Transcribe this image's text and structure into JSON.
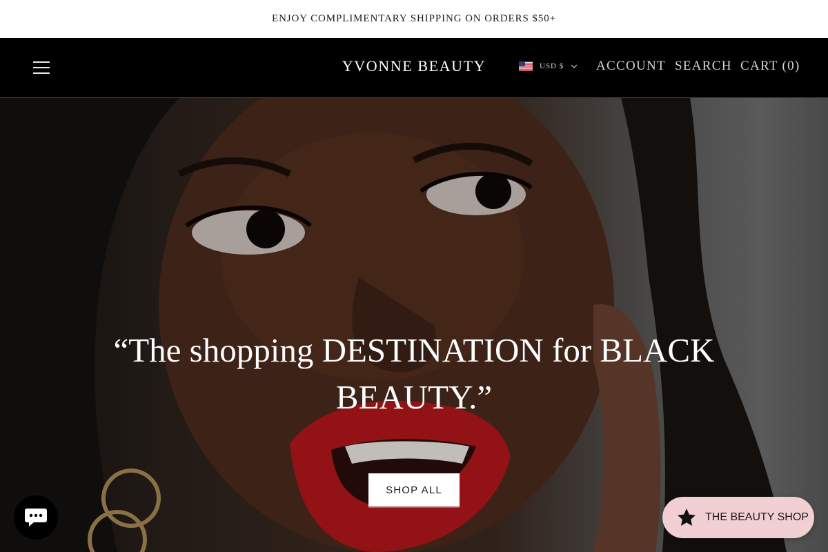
{
  "announcement": {
    "text": "ENJOY COMPLIMENTARY SHIPPING ON ORDERS $50+"
  },
  "header": {
    "logo": "YVONNE BEAUTY",
    "currency": "USD $",
    "nav": {
      "account": "ACCOUNT",
      "search": "SEARCH",
      "cart": "CART (0)"
    }
  },
  "hero": {
    "headline": "“The shopping DESTINATION for BLACK BEAUTY.”",
    "cta": "SHOP ALL"
  },
  "widgets": {
    "beauty_shop": "THE BEAUTY SHOP"
  },
  "icons": {
    "menu": "hamburger-menu-icon",
    "flag": "us-flag-icon",
    "chevron": "chevron-down-icon",
    "chat": "chat-bubble-icon",
    "star": "star-icon"
  },
  "colors": {
    "header_bg": "#000000",
    "announcement_bg": "#ffffff",
    "pill_bg": "#f1cfd3",
    "lip_red": "#b3171b"
  }
}
